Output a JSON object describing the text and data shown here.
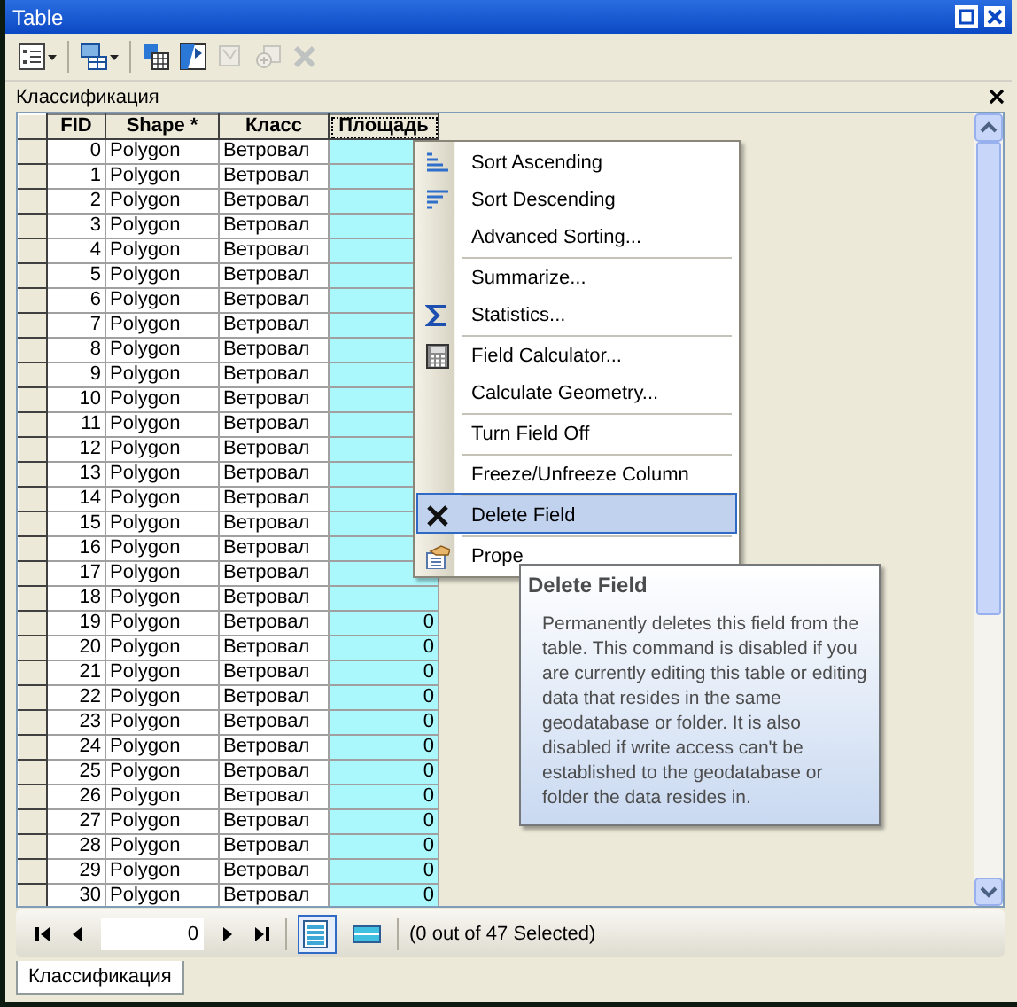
{
  "window": {
    "title": "Table"
  },
  "toolbar": [
    {
      "kind": "table-options",
      "dropdown": true,
      "disabled": false
    },
    {
      "kind": "related-tables",
      "dropdown": true,
      "disabled": false
    },
    {
      "kind": "select-by-attributes",
      "dropdown": false,
      "disabled": false
    },
    {
      "kind": "switch-selection",
      "dropdown": false,
      "disabled": false
    },
    {
      "kind": "clear-selection",
      "dropdown": false,
      "disabled": true
    },
    {
      "kind": "zoom-selected",
      "dropdown": false,
      "disabled": true
    },
    {
      "kind": "delete-selected",
      "dropdown": false,
      "disabled": true
    }
  ],
  "panel": {
    "title": "Классификация"
  },
  "table": {
    "columns": [
      {
        "label": "FID",
        "kind": "number",
        "selected": false
      },
      {
        "label": "Shape *",
        "kind": "text",
        "selected": false
      },
      {
        "label": "Класс",
        "kind": "text",
        "selected": false
      },
      {
        "label": "Площадь",
        "kind": "number",
        "selected": true
      }
    ],
    "rows": [
      {
        "cells": [
          "0",
          "Polygon",
          "Ветровал"
        ]
      },
      {
        "cells": [
          "1",
          "Polygon",
          "Ветровал"
        ]
      },
      {
        "cells": [
          "2",
          "Polygon",
          "Ветровал"
        ]
      },
      {
        "cells": [
          "3",
          "Polygon",
          "Ветровал"
        ]
      },
      {
        "cells": [
          "4",
          "Polygon",
          "Ветровал"
        ]
      },
      {
        "cells": [
          "5",
          "Polygon",
          "Ветровал"
        ]
      },
      {
        "cells": [
          "6",
          "Polygon",
          "Ветровал"
        ]
      },
      {
        "cells": [
          "7",
          "Polygon",
          "Ветровал"
        ]
      },
      {
        "cells": [
          "8",
          "Polygon",
          "Ветровал"
        ]
      },
      {
        "cells": [
          "9",
          "Polygon",
          "Ветровал"
        ]
      },
      {
        "cells": [
          "10",
          "Polygon",
          "Ветровал"
        ]
      },
      {
        "cells": [
          "11",
          "Polygon",
          "Ветровал"
        ]
      },
      {
        "cells": [
          "12",
          "Polygon",
          "Ветровал"
        ]
      },
      {
        "cells": [
          "13",
          "Polygon",
          "Ветровал"
        ]
      },
      {
        "cells": [
          "14",
          "Polygon",
          "Ветровал"
        ]
      },
      {
        "cells": [
          "15",
          "Polygon",
          "Ветровал"
        ]
      },
      {
        "cells": [
          "16",
          "Polygon",
          "Ветровал"
        ]
      },
      {
        "cells": [
          "17",
          "Polygon",
          "Ветровал"
        ]
      },
      {
        "cells": [
          "18",
          "Polygon",
          "Ветровал"
        ]
      },
      {
        "cells": [
          "19",
          "Polygon",
          "Ветровал",
          "0"
        ]
      },
      {
        "cells": [
          "20",
          "Polygon",
          "Ветровал",
          "0"
        ]
      },
      {
        "cells": [
          "21",
          "Polygon",
          "Ветровал",
          "0"
        ]
      },
      {
        "cells": [
          "22",
          "Polygon",
          "Ветровал",
          "0"
        ]
      },
      {
        "cells": [
          "23",
          "Polygon",
          "Ветровал",
          "0"
        ]
      },
      {
        "cells": [
          "24",
          "Polygon",
          "Ветровал",
          "0"
        ]
      },
      {
        "cells": [
          "25",
          "Polygon",
          "Ветровал",
          "0"
        ]
      },
      {
        "cells": [
          "26",
          "Polygon",
          "Ветровал",
          "0"
        ]
      },
      {
        "cells": [
          "27",
          "Polygon",
          "Ветровал",
          "0"
        ]
      },
      {
        "cells": [
          "28",
          "Polygon",
          "Ветровал",
          "0"
        ]
      },
      {
        "cells": [
          "29",
          "Polygon",
          "Ветровал",
          "0"
        ]
      },
      {
        "cells": [
          "30",
          "Polygon",
          "Ветровал",
          "0"
        ]
      }
    ]
  },
  "context_menu": {
    "items": [
      {
        "label": "Sort Ascending",
        "kind": "ascending",
        "separator_before": false,
        "selected": false
      },
      {
        "label": "Sort Descending",
        "kind": "descending",
        "separator_before": false,
        "selected": false
      },
      {
        "label": "Advanced Sorting...",
        "kind": "plain",
        "separator_before": false,
        "selected": false
      },
      {
        "label": "Summarize...",
        "kind": "plain",
        "separator_before": true,
        "selected": false
      },
      {
        "label": "Statistics...",
        "kind": "statistics",
        "separator_before": false,
        "selected": false
      },
      {
        "label": "Field Calculator...",
        "kind": "calculator",
        "separator_before": true,
        "selected": false
      },
      {
        "label": "Calculate Geometry...",
        "kind": "plain",
        "separator_before": false,
        "selected": false
      },
      {
        "label": "Turn Field Off",
        "kind": "plain",
        "separator_before": true,
        "selected": false
      },
      {
        "label": "Freeze/Unfreeze Column",
        "kind": "plain",
        "separator_before": true,
        "selected": false
      },
      {
        "label": "Delete Field",
        "kind": "delete",
        "separator_before": true,
        "selected": true
      },
      {
        "label": "Prope",
        "kind": "properties",
        "separator_before": true,
        "selected": false
      }
    ]
  },
  "tooltip": {
    "title": "Delete Field",
    "text": "Permanently deletes this field from the table. This command is disabled if you are currently editing this table or editing data that resides in the same geodatabase or folder. It is also disabled if write access can't be established to the geodatabase or folder the data resides in."
  },
  "footer": {
    "record": "0",
    "views": [
      {
        "kind": "all-records",
        "selected": true
      },
      {
        "kind": "selected-records",
        "selected": false
      }
    ],
    "status": "(0 out of 47 Selected)"
  },
  "tabs": [
    {
      "label": "Классификация",
      "selected": true
    }
  ]
}
